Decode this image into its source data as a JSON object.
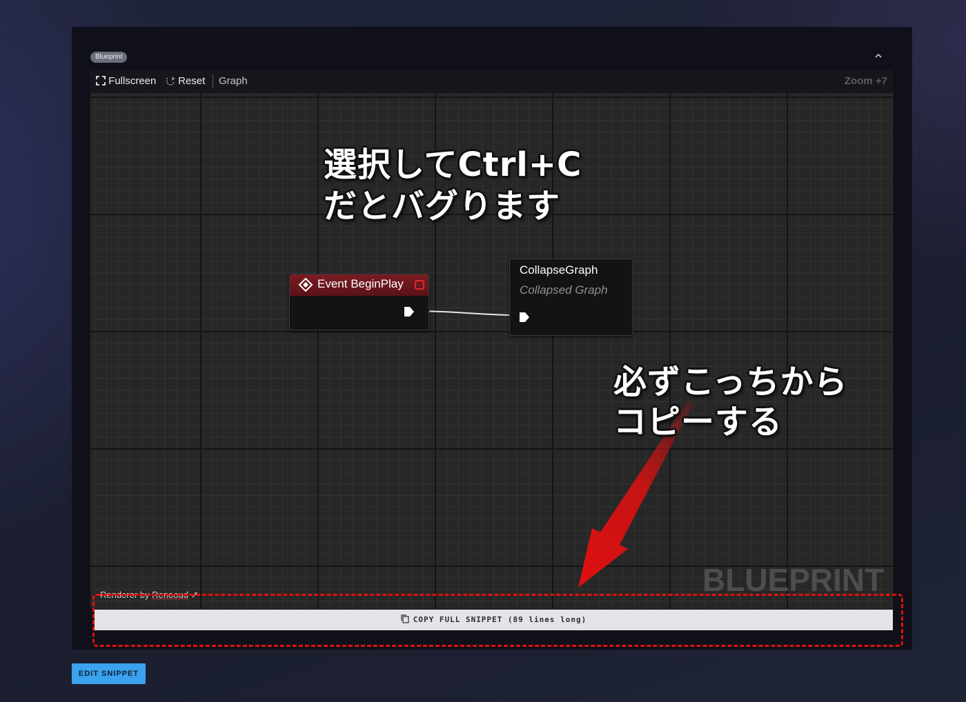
{
  "panel": {
    "badge": "Blueprint",
    "collapse_icon": "chevron-up-icon"
  },
  "toolbar": {
    "fullscreen_label": "Fullscreen",
    "reset_label": "Reset",
    "graph_label": "Graph",
    "zoom_label": "Zoom +7"
  },
  "nodes": {
    "begin_play": {
      "title": "Event BeginPlay",
      "header_color": "#7a1c22"
    },
    "collapse_graph": {
      "title": "CollapseGraph",
      "subtitle": "Collapsed Graph"
    }
  },
  "annotations": {
    "top_line1": "選択してCtrl+C",
    "top_line2": "だとバグります",
    "bottom_line1": "必ずこっちから",
    "bottom_line2": "コピーする",
    "arrow_color": "#e01010"
  },
  "footer": {
    "renderer_prefix": "Renderer by ",
    "renderer_name": "Renooud",
    "watermark": "BLUEPRINT",
    "copy_label": "COPY FULL SNIPPET",
    "copy_detail": "(89 lines long)",
    "edit_button": "EDIT SNIPPET"
  }
}
